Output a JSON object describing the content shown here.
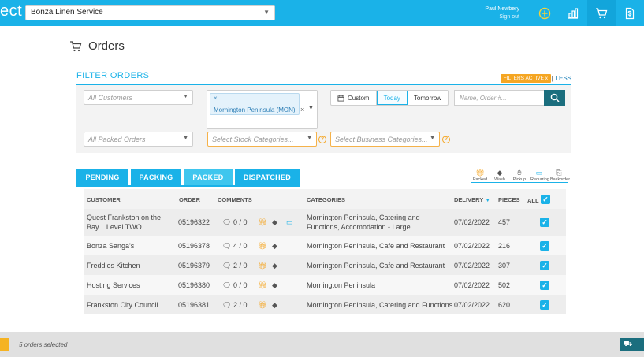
{
  "topbar": {
    "brand": "ect",
    "company": "Bonza Linen Service",
    "user_name": "Paul Newbery",
    "sign_out": "Sign out",
    "icons": [
      "add-circle-icon",
      "chart-icon",
      "cart-icon",
      "invoice-icon"
    ],
    "accent": "#1ab2e8"
  },
  "page": {
    "title": "Orders"
  },
  "filters": {
    "heading": "FILTER ORDERS",
    "active_badge": "FILTERS ACTIVE",
    "active_badge_x": "x",
    "separator": "|",
    "less_label": "LESS",
    "customers_placeholder": "All Customers",
    "selected_tag": "Mornington Peninsula (MON)",
    "tag_remove": "×",
    "clear_all": "×",
    "date_custom": "Custom",
    "date_today": "Today",
    "date_tomorrow": "Tomorrow",
    "search_placeholder": "Name, Order #...",
    "packed_placeholder": "All Packed Orders",
    "stock_placeholder": "Select Stock Categories...",
    "business_placeholder": "Select Business Categories...",
    "help": "?"
  },
  "tabs": [
    {
      "label": "PENDING",
      "active": false
    },
    {
      "label": "PACKING",
      "active": false
    },
    {
      "label": "PACKED",
      "active": true
    },
    {
      "label": "DISPATCHED",
      "active": false
    }
  ],
  "legend": [
    "Packed",
    "Wash",
    "Pickup",
    "Recurring",
    "Backorder"
  ],
  "table": {
    "headers": {
      "customer": "CUSTOMER",
      "order": "ORDER",
      "comments": "COMMENTS",
      "categories": "CATEGORIES",
      "delivery": "DELIVERY",
      "pieces": "PIECES",
      "all": "ALL"
    },
    "rows": [
      {
        "customer": "Quest Frankston on the Bay... Level TWO",
        "order": "05196322",
        "comments": "0 / 0",
        "categories": "Mornington Peninsula, Catering and Functions, Accomodation - Large",
        "delivery": "07/02/2022",
        "pieces": "457",
        "recurring": true
      },
      {
        "customer": "Bonza Sanga's",
        "order": "05196378",
        "comments": "4 / 0",
        "categories": "Mornington Peninsula, Cafe and Restaurant",
        "delivery": "07/02/2022",
        "pieces": "216",
        "recurring": false
      },
      {
        "customer": "Freddies Kitchen",
        "order": "05196379",
        "comments": "2 / 0",
        "categories": "Mornington Peninsula, Cafe and Restaurant",
        "delivery": "07/02/2022",
        "pieces": "307",
        "recurring": false
      },
      {
        "customer": "Hosting Services",
        "order": "05196380",
        "comments": "0 / 0",
        "categories": "Mornington Peninsula",
        "delivery": "07/02/2022",
        "pieces": "502",
        "recurring": false
      },
      {
        "customer": "Frankston City Council",
        "order": "05196381",
        "comments": "2 / 0",
        "categories": "Mornington Peninsula, Catering and Functions",
        "delivery": "07/02/2022",
        "pieces": "620",
        "recurring": false
      }
    ]
  },
  "footer": {
    "selected_text": "5 orders selected"
  }
}
